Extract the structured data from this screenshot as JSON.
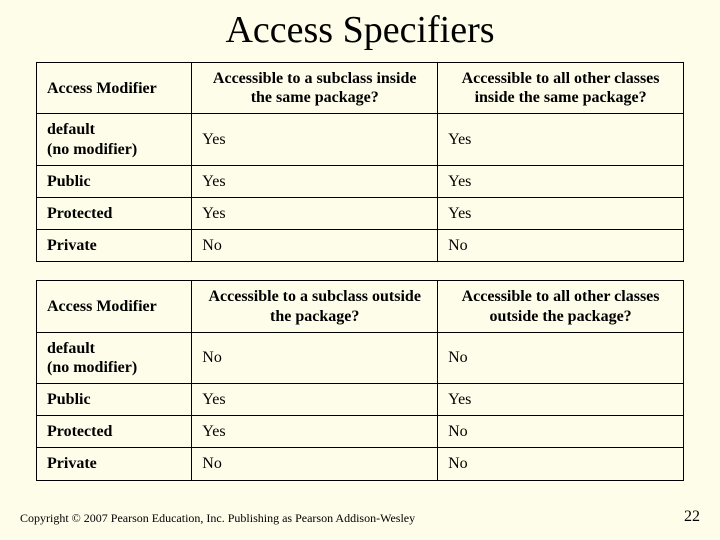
{
  "title": "Access Specifiers",
  "table1": {
    "h1": "Access Modifier",
    "h2": "Accessible to a subclass inside the same package?",
    "h3": "Accessible to all other classes inside the same package?",
    "rows": [
      {
        "label": "default\n(no modifier)",
        "c2": "Yes",
        "c3": "Yes"
      },
      {
        "label": "Public",
        "c2": "Yes",
        "c3": "Yes"
      },
      {
        "label": "Protected",
        "c2": "Yes",
        "c3": "Yes"
      },
      {
        "label": "Private",
        "c2": "No",
        "c3": "No"
      }
    ]
  },
  "table2": {
    "h1": "Access Modifier",
    "h2": "Accessible to a subclass outside the package?",
    "h3": "Accessible to all other classes outside the package?",
    "rows": [
      {
        "label": "default\n(no modifier)",
        "c2": "No",
        "c3": "No"
      },
      {
        "label": "Public",
        "c2": "Yes",
        "c3": "Yes"
      },
      {
        "label": "Protected",
        "c2": "Yes",
        "c3": "No"
      },
      {
        "label": "Private",
        "c2": "No",
        "c3": "No"
      }
    ]
  },
  "footer": "Copyright © 2007 Pearson Education, Inc. Publishing as Pearson Addison-Wesley",
  "page": "22"
}
